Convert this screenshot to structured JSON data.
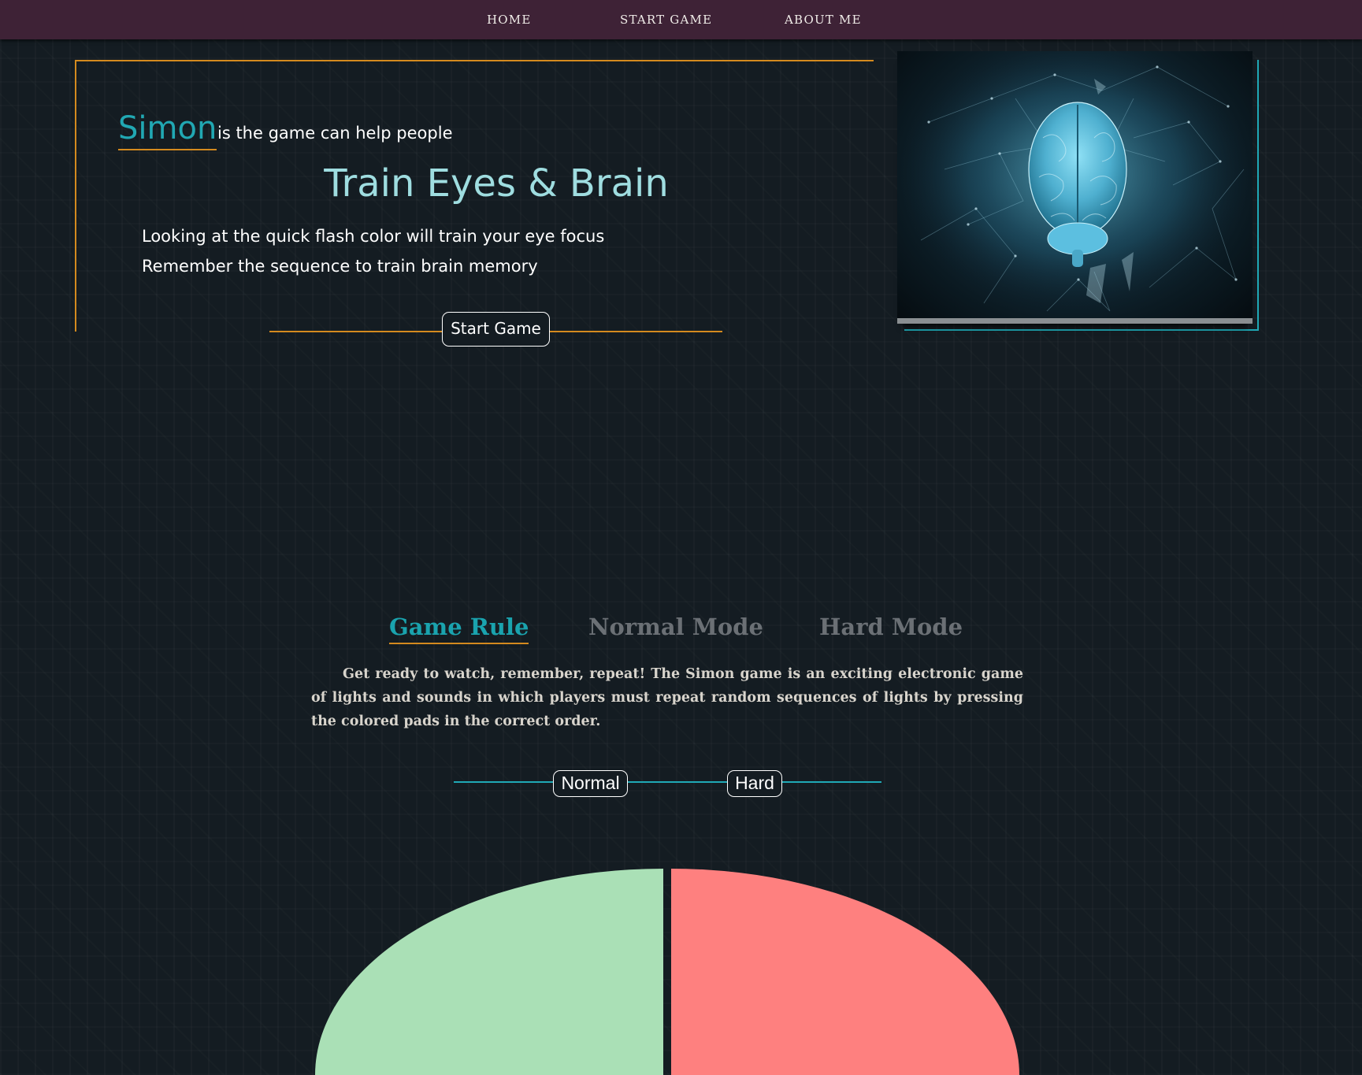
{
  "nav": {
    "home": "HOME",
    "start_game": "START GAME",
    "about_me": "ABOUT ME"
  },
  "hero": {
    "brand": "Simon",
    "tagline": "is the game can help people",
    "title": "Train Eyes & Brain",
    "line1": "Looking at the quick flash color will train your eye focus",
    "line2": "Remember the sequence to train brain memory",
    "cta": "Start Game",
    "image_alt": "glowing brain network illustration"
  },
  "tabs": [
    {
      "label": "Game Rule",
      "active": true
    },
    {
      "label": "Normal Mode",
      "active": false
    },
    {
      "label": "Hard Mode",
      "active": false
    }
  ],
  "rule_text": "Get ready to watch, remember, repeat! The Simon game is an exciting electronic game of lights and sounds in which players must repeat random sequences of lights by pressing the colored pads in the correct order.",
  "modes": {
    "normal": "Normal",
    "hard": "Hard"
  },
  "pads": [
    {
      "name": "green",
      "color": "#aae0b6"
    },
    {
      "name": "red",
      "color": "#fe807f"
    }
  ],
  "colors": {
    "navbar": "#3e2236",
    "accent_teal": "#1aa3ae",
    "accent_orange": "#d48a1e",
    "background": "#141c22"
  }
}
